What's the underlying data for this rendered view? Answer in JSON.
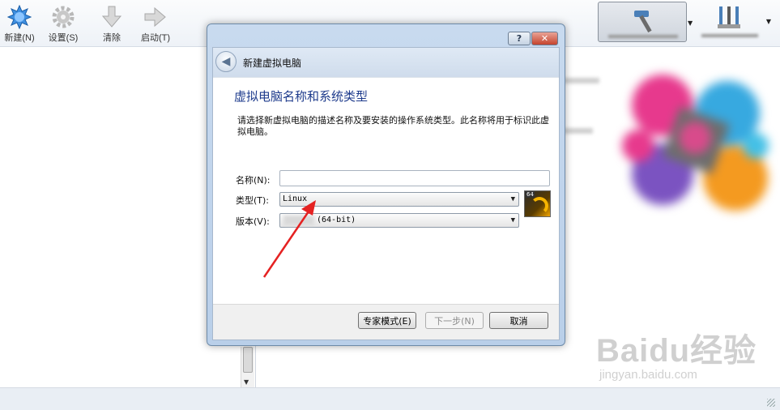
{
  "toolbar": {
    "new_label": "新建(N)",
    "settings_label": "设置(S)",
    "clear_label": "清除",
    "start_label": "启动(T)"
  },
  "dialog": {
    "title": "新建虚拟电脑",
    "heading": "虚拟电脑名称和系统类型",
    "description": "请选择新虚拟电脑的描述名称及要安装的操作系统类型。此名称将用于标识此虚拟电脑。",
    "name_label": "名称(N):",
    "name_value": "",
    "type_label": "类型(T):",
    "type_value": "Linux",
    "version_label": "版本(V):",
    "version_value": "(64-bit)",
    "os_badge": "64",
    "help_button": "?",
    "buttons": {
      "expert": "专家模式(E)",
      "next": "下一步(N)",
      "cancel": "取消"
    }
  },
  "watermark": {
    "main": "Baidu经验",
    "sub": "jingyan.baidu.com"
  },
  "colors": {
    "heading_blue": "#1e3b8c",
    "annotation_red": "#e52222",
    "close_red": "#c5442e"
  }
}
